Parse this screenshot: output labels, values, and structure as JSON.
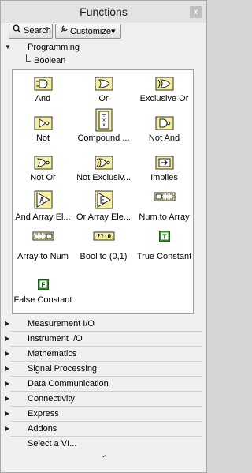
{
  "window": {
    "title": "Functions",
    "close_glyph": "x"
  },
  "toolbar": {
    "search_label": "Search",
    "customize_label": "Customize",
    "customize_caret": "▾"
  },
  "tree": {
    "programming": {
      "label": "Programming",
      "arrow": "▼"
    },
    "boolean": {
      "label": "Boolean"
    }
  },
  "palette_items": [
    {
      "label": "And",
      "icon": "and-icon"
    },
    {
      "label": "Or",
      "icon": "or-icon"
    },
    {
      "label": "Exclusive Or",
      "icon": "exclusive-or-icon"
    },
    {
      "label": "Not",
      "icon": "not-icon"
    },
    {
      "label": "Compound ...",
      "icon": "compound-arithmetic-icon"
    },
    {
      "label": "Not And",
      "icon": "not-and-icon"
    },
    {
      "label": "Not Or",
      "icon": "not-or-icon"
    },
    {
      "label": "Not Exclusiv...",
      "icon": "not-exclusive-or-icon"
    },
    {
      "label": "Implies",
      "icon": "implies-icon"
    },
    {
      "label": "And Array El...",
      "icon": "and-array-elements-icon"
    },
    {
      "label": "Or Array Ele...",
      "icon": "or-array-elements-icon"
    },
    {
      "label": "Num to Array",
      "icon": "num-to-array-icon"
    },
    {
      "label": "Array to Num",
      "icon": "array-to-num-icon"
    },
    {
      "label": "Bool to (0,1)",
      "icon": "bool-to-01-icon"
    },
    {
      "label": "True Constant",
      "icon": "true-constant-icon"
    },
    {
      "label": "False Constant",
      "icon": "false-constant-icon"
    }
  ],
  "categories": [
    {
      "label": "Measurement I/O",
      "arrow": "▶"
    },
    {
      "label": "Instrument I/O",
      "arrow": "▶"
    },
    {
      "label": "Mathematics",
      "arrow": "▶"
    },
    {
      "label": "Signal Processing",
      "arrow": "▶"
    },
    {
      "label": "Data Communication",
      "arrow": "▶"
    },
    {
      "label": "Connectivity",
      "arrow": "▶"
    },
    {
      "label": "Express",
      "arrow": "▶"
    },
    {
      "label": "Addons",
      "arrow": "▶"
    }
  ],
  "select_vi": {
    "label": "Select a VI..."
  },
  "more_glyph": "⌄",
  "icon_texts": {
    "true_letter": "T",
    "false_letter": "F",
    "bool01_text": "?1:0"
  },
  "colors": {
    "accent_yellow": "#f4f0a0",
    "icon_outline": "#333333",
    "constant_green": "#2e8b2e"
  }
}
